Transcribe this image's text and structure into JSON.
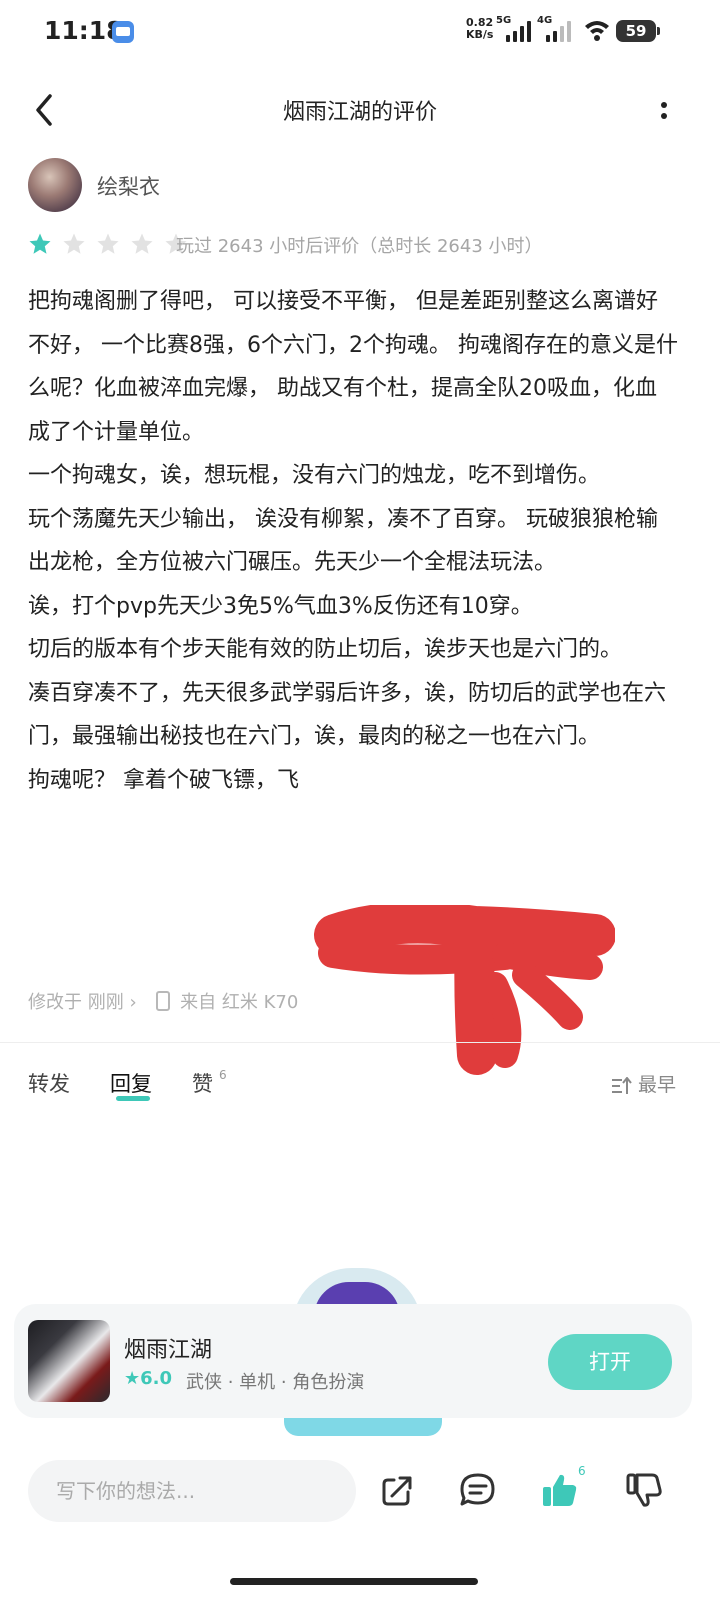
{
  "status_bar": {
    "time": "11:18",
    "net_speed_value": "0.82",
    "net_speed_unit": "KB/s",
    "sim1_label": "5G",
    "sim2_label": "4G",
    "battery": "59"
  },
  "header": {
    "title": "烟雨江湖的评价"
  },
  "author": {
    "name": "绘梨衣"
  },
  "rating": {
    "stars": 1,
    "max_stars": 5,
    "playtime_text": "玩过 2643 小时后评价（总时长 2643 小时）"
  },
  "review": {
    "paragraphs": [
      "把拘魂阁删了得吧， 可以接受不平衡， 但是差距别整这么离谱好不好， 一个比赛8强，6个六门，2个拘魂。 拘魂阁存在的意义是什么呢？化血被淬血完爆， 助战又有个杜，提高全队20吸血，化血成了个计量单位。",
      "一个拘魂女，诶，想玩棍，没有六门的烛龙，吃不到增伤。",
      "玩个荡魔先天少输出， 诶没有柳絮，凑不了百穿。 玩破狼狼枪输出龙枪，全方位被六门碾压。先天少一个全棍法玩法。",
      "诶，打个pvp先天少3免5%气血3%反伤还有10穿。",
      "切后的版本有个步天能有效的防止切后，诶步天也是六门的。",
      "凑百穿凑不了，先天很多武学弱后许多，诶，防切后的武学也在六门，最强输出秘技也在六门，诶，最肉的秘之一也在六门。",
      "拘魂呢？ 拿着个破飞镖，飞"
    ]
  },
  "meta": {
    "modified_text": "修改于 刚刚 ›",
    "device_text": "来自 红米 K70"
  },
  "actions": {
    "forward": "转发",
    "reply": "回复",
    "like": "赞",
    "like_count": "6",
    "sort": "最早"
  },
  "game_card": {
    "name": "烟雨江湖",
    "score": "6.0",
    "tags": "武侠 · 单机 · 角色扮演",
    "open_button": "打开"
  },
  "bottom_bar": {
    "input_placeholder": "写下你的想法...",
    "like_count": "6"
  },
  "colors": {
    "accent": "#3ec8b8",
    "open_button": "#5fd6c5",
    "star_active": "#3ec8b8",
    "star_inactive": "#e2e2e2",
    "redaction": "#e03c3c"
  },
  "icons": {
    "back": "chevron-left-icon",
    "more": "more-vertical-icon",
    "share": "share-icon",
    "comment": "comment-icon",
    "like": "thumbs-up-icon",
    "dislike": "thumbs-down-icon",
    "sort": "sort-icon",
    "device": "phone-icon"
  }
}
